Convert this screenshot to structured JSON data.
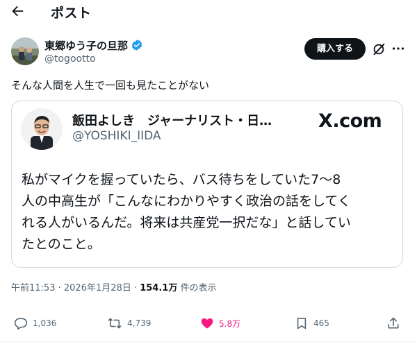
{
  "header": {
    "title": "ポスト"
  },
  "author": {
    "name": "東郷ゆう子の旦那",
    "handle": "@togootto",
    "verified": true
  },
  "actions_top": {
    "purchase_label": "購入する"
  },
  "post": {
    "text": "そんな人間を人生で一回も見たことがない"
  },
  "quoted_card": {
    "name": "飯田よしき　ジャーナリスト・日…",
    "handle": "@YOSHIKI_IIDA",
    "brand": "X.com",
    "body_lines": [
      "私がマイクを握っていたら、バス待ちをしていた7〜8",
      "人の中高生が「こんなにわかりやすく政治の話をしてく",
      "れる人がいるんだ。将来は共産党一択だな」と話してい",
      "たとのこと。"
    ]
  },
  "meta": {
    "time": "午前11:53",
    "separator": "·",
    "date": "2026年1月28日",
    "views": "154.1万",
    "views_label": "件の表示"
  },
  "stats": {
    "replies": "1,036",
    "reposts": "4,739",
    "likes": "5.8万",
    "bookmarks": "465"
  },
  "colors": {
    "text": "#0f1419",
    "secondary": "#536471",
    "like": "#f91880",
    "verified": "#1d9bf0",
    "border": "#cfd9de"
  },
  "icons": [
    "back-arrow-icon",
    "verified-icon",
    "grok-icon",
    "more-icon",
    "reply-icon",
    "repost-icon",
    "heart-icon",
    "bookmark-icon",
    "share-icon"
  ]
}
